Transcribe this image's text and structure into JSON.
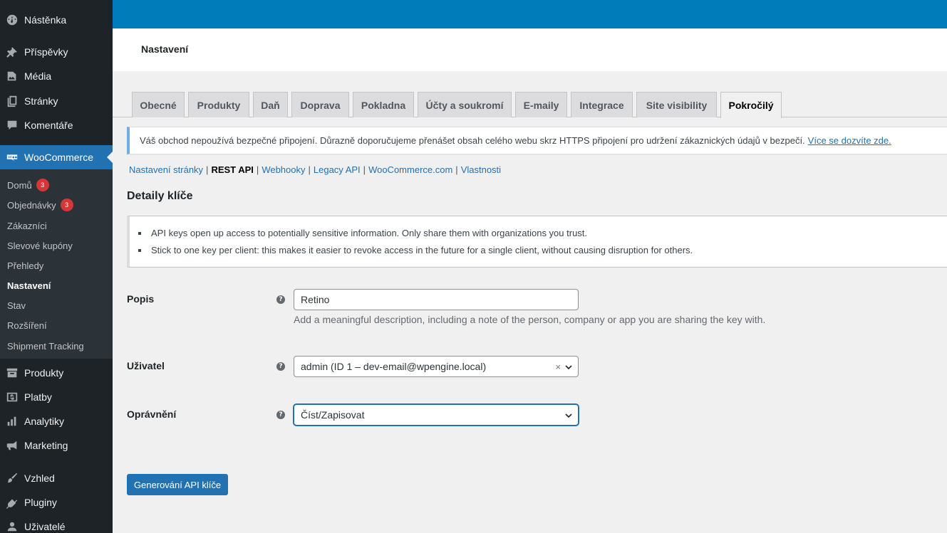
{
  "sidebar": {
    "main_items": [
      {
        "label": "Nástěnka",
        "icon": "dashboard-icon"
      },
      {
        "label": "Příspěvky",
        "icon": "pin-icon"
      },
      {
        "label": "Média",
        "icon": "media-icon"
      },
      {
        "label": "Stránky",
        "icon": "pages-icon"
      },
      {
        "label": "Komentáře",
        "icon": "comment-icon"
      },
      {
        "label": "WooCommerce",
        "icon": "woocommerce-icon"
      }
    ],
    "sub_items": [
      {
        "label": "Domů",
        "badge": "3"
      },
      {
        "label": "Objednávky",
        "badge": "3"
      },
      {
        "label": "Zákazníci"
      },
      {
        "label": "Slevové kupóny"
      },
      {
        "label": "Přehledy"
      },
      {
        "label": "Nastavení"
      },
      {
        "label": "Stav"
      },
      {
        "label": "Rozšíření"
      },
      {
        "label": "Shipment Tracking"
      }
    ],
    "lower_items": [
      {
        "label": "Produkty",
        "icon": "archive-icon"
      },
      {
        "label": "Platby",
        "icon": "dollar-icon"
      },
      {
        "label": "Analytiky",
        "icon": "chart-bars-icon"
      },
      {
        "label": "Marketing",
        "icon": "megaphone-icon"
      },
      {
        "label": "Vzhled",
        "icon": "paintbrush-icon"
      },
      {
        "label": "Pluginy",
        "icon": "plugin-icon"
      },
      {
        "label": "Uživatelé",
        "icon": "user-icon"
      }
    ]
  },
  "header": {
    "title": "Nastavení"
  },
  "tabs": [
    "Obecné",
    "Produkty",
    "Daň",
    "Doprava",
    "Pokladna",
    "Účty a soukromí",
    "E-maily",
    "Integrace",
    "Site visibility",
    "Pokročilý"
  ],
  "notice": {
    "text": "Váš obchod nepoužívá bezpečné připojení. Důrazně doporučujeme přenášet obsah celého webu skrz HTTPS připojení pro udržení zákaznických údajů v bezpečí.",
    "link": "Více se dozvíte zde."
  },
  "subnav": [
    "Nastavení stránky",
    "REST API",
    "Webhooky",
    "Legacy API",
    "WooCommerce.com",
    "Vlastnosti"
  ],
  "section_title": "Detaily klíče",
  "info": [
    "API keys open up access to potentially sensitive information. Only share them with organizations you trust.",
    "Stick to one key per client: this makes it easier to revoke access in the future for a single client, without causing disruption for others."
  ],
  "form": {
    "description": {
      "label": "Popis",
      "value": "Retino",
      "help": "Add a meaningful description, including a note of the person, company or app you are sharing the key with."
    },
    "user": {
      "label": "Uživatel",
      "value": "admin (ID 1 – dev-email@wpengine.local)",
      "clear": "×"
    },
    "permissions": {
      "label": "Oprávnění",
      "value": "Číst/Zapisovat"
    },
    "help_glyph": "?"
  },
  "generate_button": "Generování API klíče",
  "colors": {
    "admin_bar": "#007cba",
    "sidebar": "#1d2327",
    "accent": "#2271b1",
    "badge": "#d63638"
  }
}
